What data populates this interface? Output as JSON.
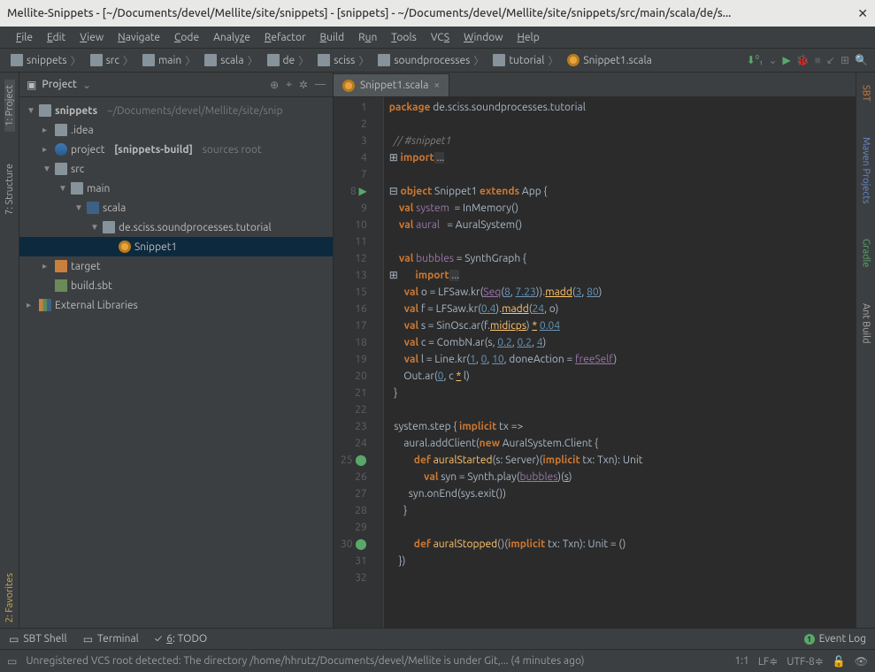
{
  "window": {
    "title": "Mellite-Snippets - [~/Documents/devel/Mellite/site/snippets] - [snippets] - ~/Documents/devel/Mellite/site/snippets/src/main/scala/de/s..."
  },
  "menu": [
    "File",
    "Edit",
    "View",
    "Navigate",
    "Code",
    "Analyze",
    "Refactor",
    "Build",
    "Run",
    "Tools",
    "VCS",
    "Window",
    "Help"
  ],
  "breadcrumbs": [
    "snippets",
    "src",
    "main",
    "scala",
    "de",
    "sciss",
    "soundprocesses",
    "tutorial",
    "Snippet1.scala"
  ],
  "projectPanel": {
    "title": "Project"
  },
  "tree": {
    "root": {
      "name": "snippets",
      "path": "~/Documents/devel/Mellite/site/snip"
    },
    "idea": ".idea",
    "project": {
      "name": "project",
      "build": "[snippets-build]",
      "note": "sources root"
    },
    "src": "src",
    "main": "main",
    "scala": "scala",
    "pkg": "de.sciss.soundprocesses.tutorial",
    "snippet": "Snippet1",
    "target": "target",
    "buildsbt": "build.sbt",
    "extlib": "External Libraries"
  },
  "tab": {
    "name": "Snippet1.scala"
  },
  "leftTools": {
    "project": "1: Project",
    "structure": "7: Structure",
    "favorites": "2: Favorites"
  },
  "rightTools": {
    "sbt": "SBT",
    "maven": "Maven Projects",
    "gradle": "Gradle",
    "ant": "Ant Build"
  },
  "bottom": {
    "sbtShell": "SBT Shell",
    "terminal": "Terminal",
    "todo": "6: TODO",
    "eventLog": "Event Log"
  },
  "status": {
    "msg": "Unregistered VCS root detected: The directory /home/hhrutz/Documents/devel/Mellite is under Git,... (4 minutes ago)",
    "pos": "1:1",
    "le": "LF",
    "enc": "UTF-8"
  },
  "code": {
    "lines": [
      1,
      2,
      3,
      4,
      7,
      8,
      9,
      10,
      11,
      12,
      13,
      15,
      16,
      17,
      18,
      19,
      20,
      21,
      22,
      23,
      24,
      25,
      26,
      27,
      28,
      29,
      30,
      31,
      32
    ],
    "l1a": "package",
    "l1b": " de.sciss.soundprocesses.tutorial",
    "l3": "// #snippet1",
    "l4a": "import",
    "l4b": " ...",
    "l8a": "object",
    "l8b": " Snippet1 ",
    "l8c": "extends",
    "l8d": " App {",
    "l9a": "  val",
    "l9b": " system",
    "l9c": "  = InMemory()",
    "l10a": "  val",
    "l10b": " aural",
    "l10c": "   = AuralSystem()",
    "l12a": "  val",
    "l12b": " bubbles",
    "l12c": " = SynthGraph {",
    "l13a": "    import",
    "l13b": " ...",
    "l15a": "    val",
    "l15b": " o = LFSaw.kr(",
    "l15c": "Seq",
    "l15d": "(",
    "l15e": "8",
    "l15f": ", ",
    "l15g": "7.23",
    "l15h": ")).",
    "l15i": "madd",
    "l15j": "(",
    "l15k": "3",
    "l15l": ", ",
    "l15m": "80",
    "l15n": ")",
    "l16a": "    val",
    "l16b": " f = LFSaw.kr(",
    "l16c": "0.4",
    "l16d": ").",
    "l16e": "madd",
    "l16f": "(",
    "l16g": "24",
    "l16h": ", o)",
    "l17a": "    val",
    "l17b": " s = SinOsc.ar(f.",
    "l17c": "midicps",
    "l17d": ") ",
    "l17e": "*",
    "l17f": " ",
    "l17g": "0.04",
    "l18a": "    val",
    "l18b": " c = CombN.ar(s, ",
    "l18c": "0.2",
    "l18d": ", ",
    "l18e": "0.2",
    "l18f": ", ",
    "l18g": "4",
    "l18h": ")",
    "l19a": "    val",
    "l19b": " l = Line.kr(",
    "l19c": "1",
    "l19d": ", ",
    "l19e": "0",
    "l19f": ", ",
    "l19g": "10",
    "l19h": ", doneAction = ",
    "l19i": "freeSelf",
    "l19j": ")",
    "l20a": "    Out.ar(",
    "l20b": "0",
    "l20c": ", c ",
    "l20d": "*",
    "l20e": " l)",
    "l21": "  }",
    "l23a": "  system.step { ",
    "l23b": "implicit",
    "l23c": " tx =>",
    "l24a": "    aural.addClient(",
    "l24b": "new",
    "l24c": " AuralSystem.Client {",
    "l25a": "      def",
    "l25b": " ",
    "l25c": "auralStarted",
    "l25d": "(s: Server)(",
    "l25e": "implicit",
    "l25f": " tx: Txn): Unit",
    "l26a": "        val",
    "l26b": " syn = Synth.play(",
    "l26c": "bubbles",
    "l26d": ")(",
    "l26e": "s",
    "l26f": ")",
    "l27": "        syn.onEnd(sys.exit())",
    "l28": "      }",
    "l30a": "      def",
    "l30b": " ",
    "l30c": "auralStopped",
    "l30d": "()(",
    "l30e": "implicit",
    "l30f": " tx: Txn): Unit = ()",
    "l31": "    })"
  }
}
